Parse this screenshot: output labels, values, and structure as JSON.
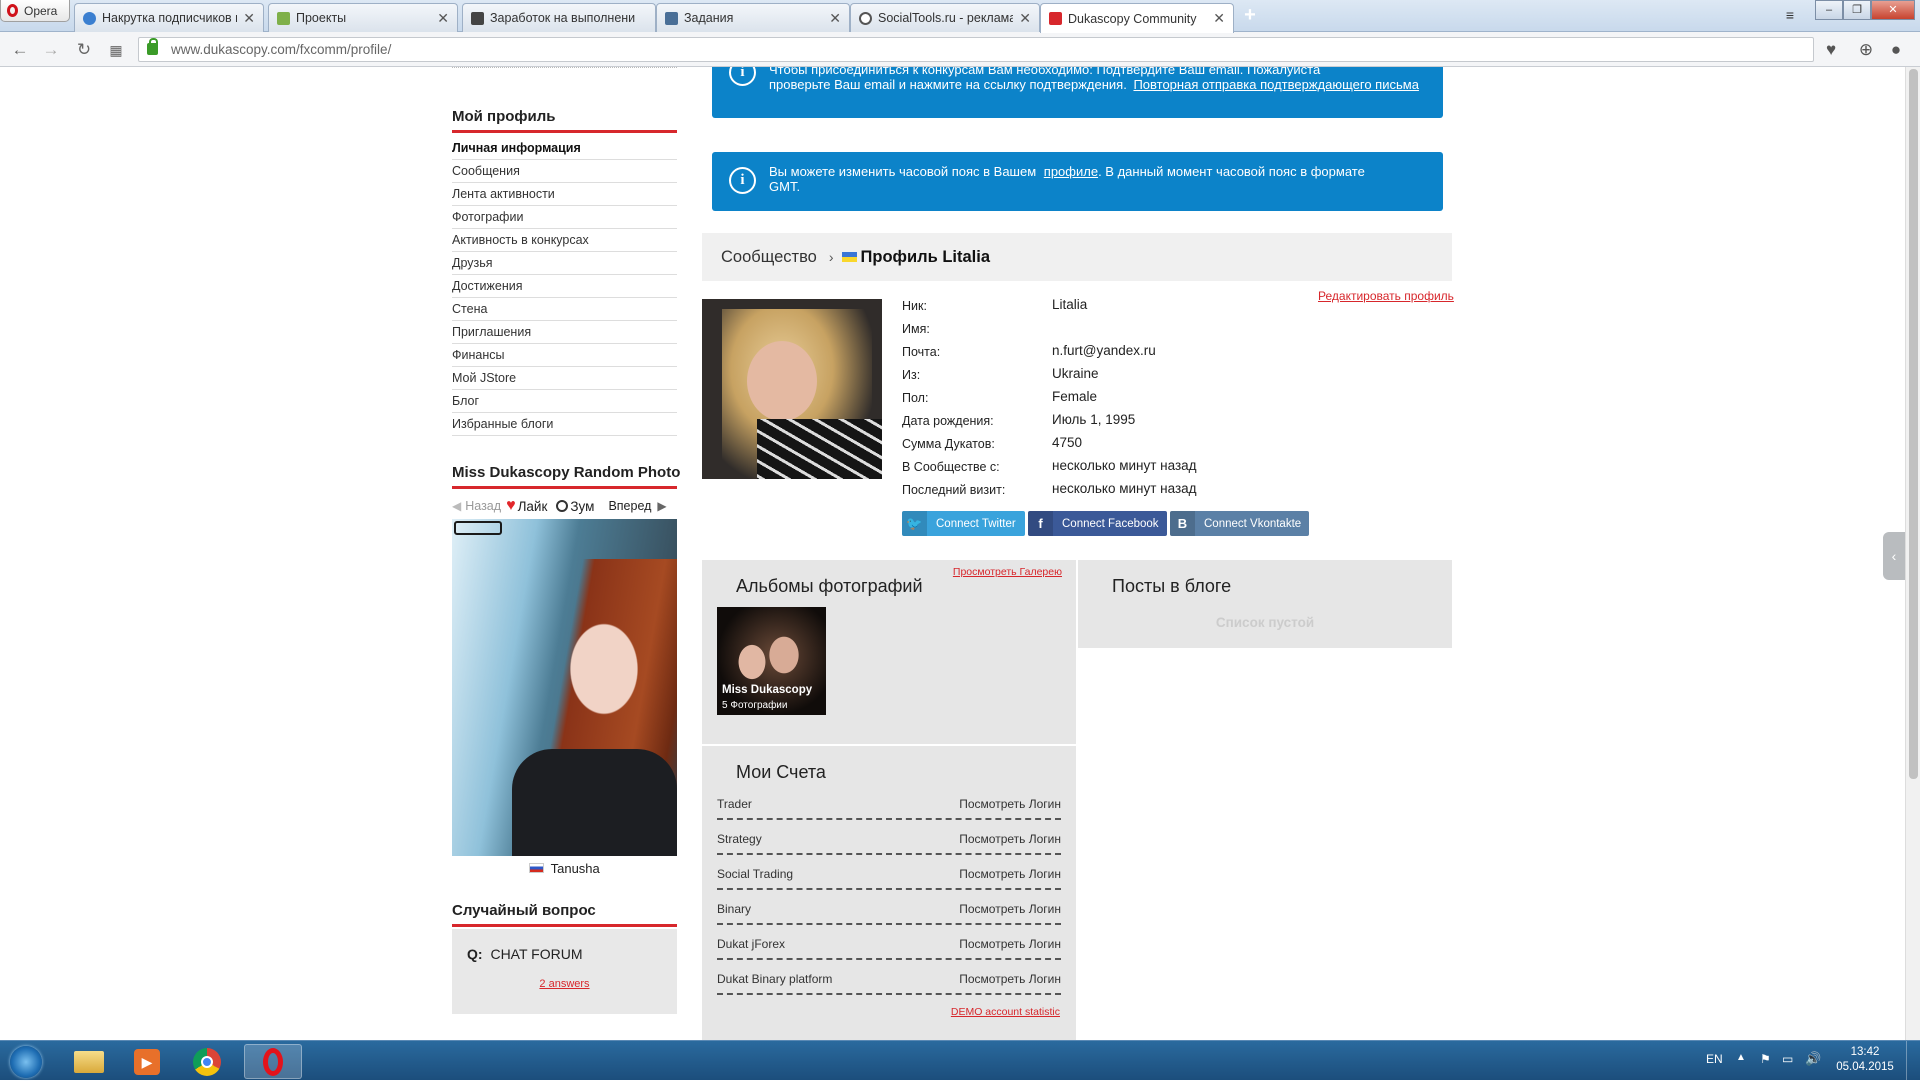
{
  "browser": {
    "opera_label": "Opera",
    "tabs": [
      {
        "label": "Накрутка подписчиков в",
        "favicon_color": "#3b7fd0"
      },
      {
        "label": "Проекты",
        "favicon_color": "#7fb04a"
      },
      {
        "label": "Заработок на выполнени",
        "favicon_color": "#444444"
      },
      {
        "label": "Задания",
        "favicon_color": "#4a6f97"
      },
      {
        "label": "SocialTools.ru - реклама в",
        "favicon_color": "#555555"
      },
      {
        "label": "Dukascopy Community",
        "favicon_color": "#d7272c"
      }
    ],
    "url": "www.dukascopy.com/fxcomm/profile/"
  },
  "sidebar": {
    "profile_heading": "Мой профиль",
    "menu": [
      "Личная информация",
      "Сообщения",
      "Лента активности",
      "Фотографии",
      "Активность в конкурсах",
      "Друзья",
      "Достижения",
      "Стена",
      "Приглашения",
      "Финансы",
      "Мой JStore",
      "Блог",
      "Избранные блоги"
    ],
    "random_photo_heading": "Miss Dukascopy Random Photo",
    "rp_back": "Назад",
    "rp_like": "Лайк",
    "rp_zoom": "Зум",
    "rp_forward": "Вперед",
    "rp_name": "Tanusha",
    "question_heading": "Случайный вопрос",
    "question_prefix": "Q:",
    "question_text": "CHAT FORUM",
    "question_answers": "2 answers"
  },
  "notices": {
    "n1_line1": "Чтобы присоединиться к конкурсам Вам необходимо: Подтвердите Ваш email. Пожалуйста",
    "n1_line2": "проверьте Ваш email и нажмите на ссылку подтверждения.",
    "n1_link": "Повторная отправка подтверждающего письма",
    "n2_text1": "Вы можете изменить часовой пояс в Вашем",
    "n2_link": "профиле",
    "n2_text2": ". В данный момент часовой пояс в формате GMT."
  },
  "breadcrumb": {
    "community": "Сообщество",
    "profile": "Профиль Litalia"
  },
  "profile": {
    "edit_link": "Редактировать профиль",
    "fields": [
      {
        "key": "Ник:",
        "value": "Litalia"
      },
      {
        "key": "Имя:",
        "value": ""
      },
      {
        "key": "Почта:",
        "value": "n.furt@yandex.ru"
      },
      {
        "key": "Из:",
        "value": "Ukraine"
      },
      {
        "key": "Пол:",
        "value": "Female"
      },
      {
        "key": "Дата рождения:",
        "value": "Июль 1, 1995"
      },
      {
        "key": "Сумма Дукатов:",
        "value": "4750"
      },
      {
        "key": "В Сообществе с:",
        "value": "несколько минут назад"
      },
      {
        "key": "Последний визит:",
        "value": "несколько минут назад"
      }
    ],
    "connect_twitter": "Connect Twitter",
    "connect_facebook": "Connect Facebook",
    "connect_vk": "Connect Vkontakte",
    "twitter_color": "#3aa3dc",
    "facebook_color": "#3b5998",
    "vk_color": "#5b80a6"
  },
  "albums": {
    "title": "Альбомы фотографий",
    "view_gallery": "Просмотреть Галерею",
    "album_name": "Miss Dukascopy",
    "album_count": "5 Фотографии"
  },
  "blog": {
    "title": "Посты в блоге",
    "empty": "Список пустой"
  },
  "accounts": {
    "title": "Мои Счета",
    "rows": [
      {
        "name": "Trader",
        "link": "Посмотреть Логин"
      },
      {
        "name": "Strategy",
        "link": "Посмотреть Логин"
      },
      {
        "name": "Social Trading",
        "link": "Посмотреть Логин"
      },
      {
        "name": "Binary",
        "link": "Посмотреть Логин"
      },
      {
        "name": "Dukat jForex",
        "link": "Посмотреть Логин"
      },
      {
        "name": "Dukat Binary platform",
        "link": "Посмотреть Логин"
      }
    ],
    "demo_link": "DEMO account statistic"
  },
  "taskbar": {
    "lang": "EN",
    "time": "13:42",
    "date": "05.04.2015"
  },
  "colors": {
    "brand_red": "#d7272c",
    "notice_blue": "#0c83c9"
  }
}
